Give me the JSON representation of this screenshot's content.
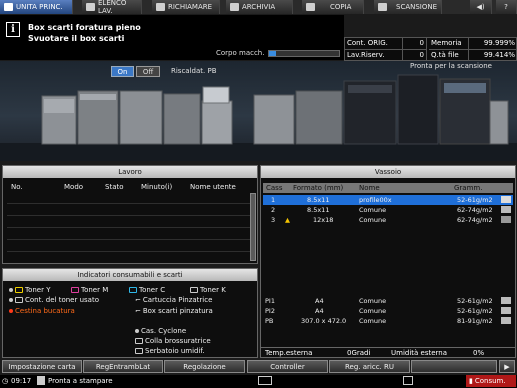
{
  "tabs": [
    {
      "label": "UNITA PRINC.",
      "icon": "home-icon"
    },
    {
      "label": "ELENCO LAV.",
      "icon": "job-list-icon"
    },
    {
      "label": "RICHIAMARE",
      "icon": "recall-icon"
    },
    {
      "label": "ARCHIVIA",
      "icon": "store-icon"
    },
    {
      "label": "COPIA",
      "icon": "copy-icon"
    },
    {
      "label": "SCANSIONE",
      "icon": "scan-icon"
    }
  ],
  "message": {
    "line1": "Box scarti foratura pieno",
    "line2": "Svuotare il box scarti"
  },
  "corpo_label": "Corpo macch.",
  "corpo_level": 0.1,
  "counters": {
    "orig_label": "Cont. ORIG.",
    "orig_value": "0",
    "memoria_label": "Memoria",
    "memoria_value": "99.999%",
    "riserv_label": "Lav.Riserv.",
    "riserv_value": "0",
    "file_label": "Q.tà file",
    "file_value": "99.414%"
  },
  "machine": {
    "status": "Pronta per la scansione",
    "on_label": "On",
    "off_label": "Off",
    "heating_label": "Riscaldat. PB"
  },
  "lavoro": {
    "title": "Lavoro",
    "columns": [
      "No.",
      "Modo",
      "Stato",
      "Minuto(i)",
      "Nome utente"
    ]
  },
  "vassoio": {
    "title": "Vassoio",
    "columns": [
      "Cass",
      "Formato (mm)",
      "Nome",
      "Gramm."
    ],
    "rows": [
      {
        "cass": "1",
        "formato": "8.5x11",
        "nome": "profile00x",
        "gramm": "52-61g/m2",
        "selected": true
      },
      {
        "cass": "2",
        "formato": "8.5x11",
        "nome": "Comune",
        "gramm": "62-74g/m2",
        "selected": false
      },
      {
        "cass": "3",
        "formato": "12x18",
        "nome": "Comune",
        "gramm": "62-74g/m2",
        "selected": false
      },
      {
        "cass": "PI1",
        "formato": "A4",
        "nome": "Comune",
        "gramm": "52-61g/m2",
        "selected": false
      },
      {
        "cass": "PI2",
        "formato": "A4",
        "nome": "Comune",
        "gramm": "52-61g/m2",
        "selected": false
      },
      {
        "cass": "PB",
        "formato": "307.0 x 472.0",
        "nome": "Comune",
        "gramm": "81-91g/m2",
        "selected": false
      }
    ],
    "temp_label": "Temp.esterna",
    "temp_value": "0Gradi",
    "umid_label": "Umidità esterna",
    "umid_value": "0%"
  },
  "consumabili": {
    "title": "Indicatori consumabili e scarti",
    "items": [
      "Toner Y",
      "Toner M",
      "Toner C",
      "Toner K",
      "Cont. del toner usato",
      "Cartuccia Pinzatrice",
      "Cestina bucatura",
      "Box scarti pinzatura",
      "Cas. Cyclone",
      "Colla brossuratrice",
      "Serbatoio umidif."
    ],
    "alert_color": "#ff6a1a"
  },
  "bottom_buttons": [
    "Impostazione carta",
    "RegEntrambLat",
    "Regolazione",
    "Controller",
    "Reg. aricc. RU"
  ],
  "status": {
    "time": "09:17",
    "text": "Pronta a stampare",
    "consum_label": "Consum."
  }
}
